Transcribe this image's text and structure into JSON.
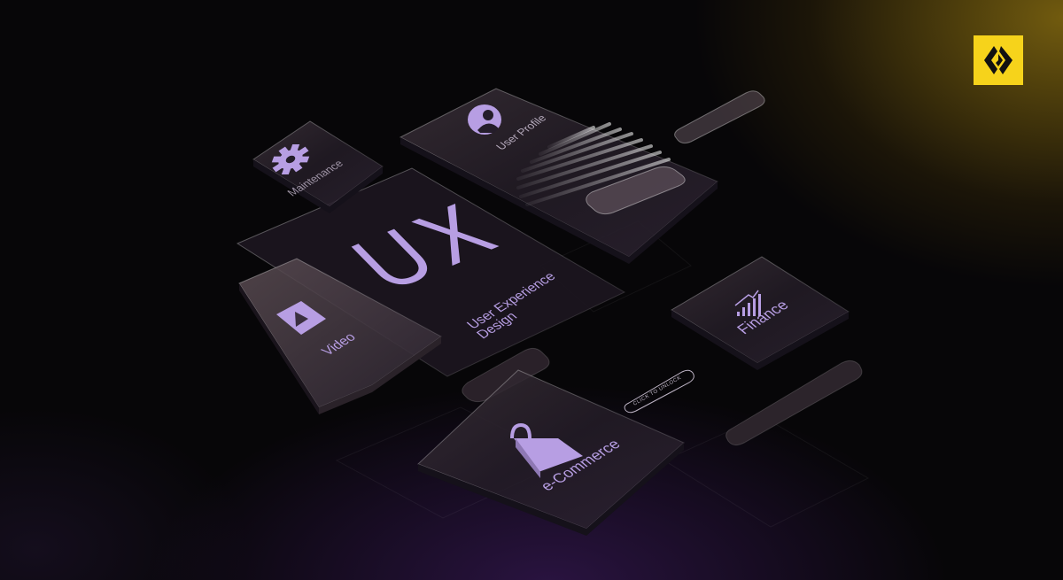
{
  "logo": {
    "icon": "brand-diamond-logo-icon",
    "color": "#f6d31b"
  },
  "ux": {
    "title": "UX",
    "subtitle_line1": "User Experience",
    "subtitle_line2": "Design"
  },
  "cards": {
    "user_profile": {
      "label": "User Profile",
      "icon": "user-avatar-icon"
    },
    "maintenance": {
      "label": "Maintenance",
      "icon": "gear-icon"
    },
    "video": {
      "label": "Video",
      "icon": "play-icon"
    },
    "finance": {
      "label": "Finance",
      "icon": "bar-chart-icon"
    },
    "ecommerce": {
      "label": "e-Commerce",
      "icon": "shopping-bag-icon"
    }
  },
  "unlock_pill": {
    "label": "CLICK TO UNLOCK"
  },
  "colors": {
    "accent": "#b79ee3",
    "brand": "#f6d31b",
    "background": "#070608"
  }
}
